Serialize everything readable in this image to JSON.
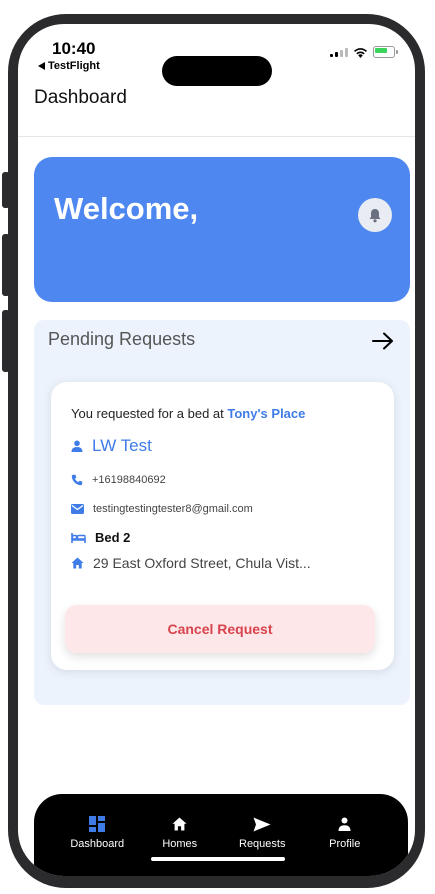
{
  "status_bar": {
    "time": "10:40",
    "back_app": "TestFlight"
  },
  "header": {
    "title": "Dashboard"
  },
  "welcome": {
    "text": "Welcome,",
    "bell_icon": "bell-icon"
  },
  "pending": {
    "title": "Pending Requests",
    "arrow_icon": "arrow-right-icon",
    "request": {
      "prefix": "You requested for a bed at",
      "place": "Tony's Place",
      "name": "LW Test",
      "phone": "+16198840692",
      "email": "testingtestingtester8@gmail.com",
      "bed": "Bed 2",
      "address": "29 East Oxford Street, Chula Vist...",
      "cancel_label": "Cancel Request"
    }
  },
  "tabs": [
    {
      "label": "Dashboard",
      "icon": "dashboard-icon",
      "active": true
    },
    {
      "label": "Homes",
      "icon": "home-icon"
    },
    {
      "label": "Requests",
      "icon": "send-icon"
    },
    {
      "label": "Profile",
      "icon": "person-icon"
    }
  ],
  "colors": {
    "accent": "#4d87ef",
    "link": "#3f7ce8",
    "danger": "#d9434d",
    "danger_bg": "#fde7e9",
    "section_bg": "#edf3fd",
    "active_tab_icon": "#3f7ce8"
  }
}
